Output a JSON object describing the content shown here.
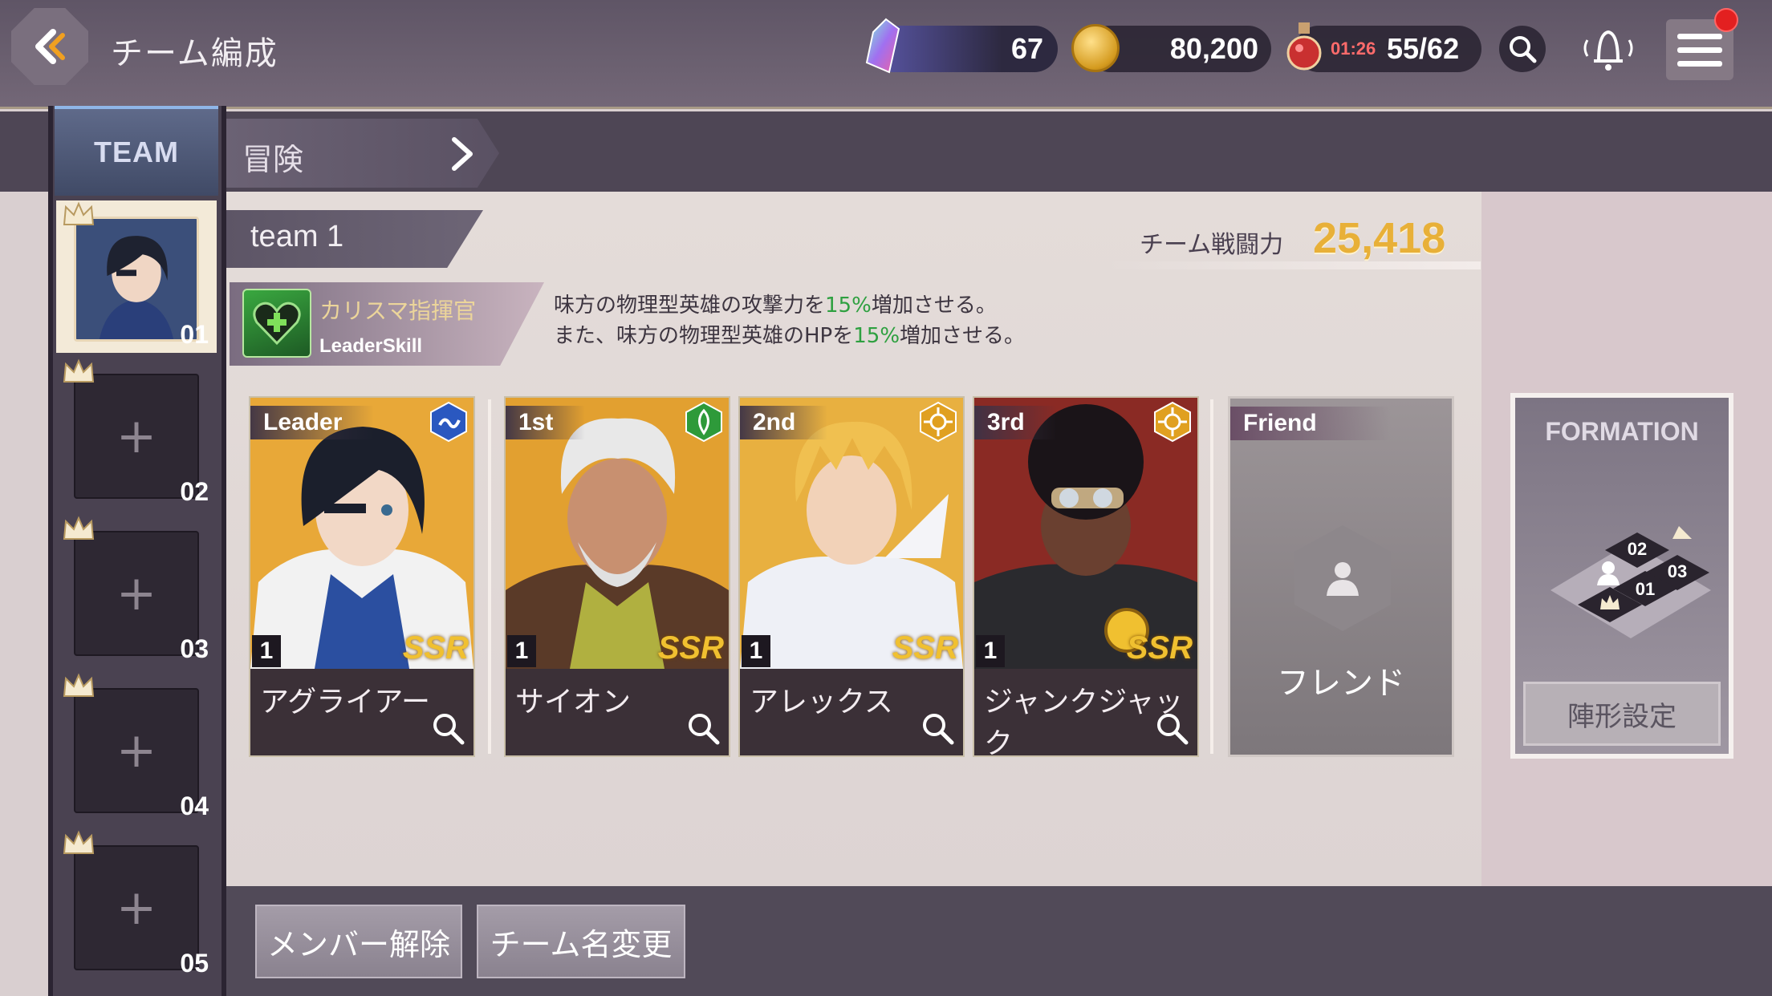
{
  "header": {
    "title": "チーム編成",
    "gems": "67",
    "coins": "80,200",
    "stamina_timer": "01:26",
    "stamina": "55/62"
  },
  "nav": {
    "team_tab": "TEAM",
    "adventure_tab": "冒険"
  },
  "team_slots": [
    {
      "num": "01"
    },
    {
      "num": "02"
    },
    {
      "num": "03"
    },
    {
      "num": "04"
    },
    {
      "num": "05"
    }
  ],
  "team": {
    "name": "team 1",
    "power_label": "チーム戦闘力",
    "power": "25,418"
  },
  "leader_skill": {
    "name": "カリスマ指揮官",
    "sub": "LeaderSkill",
    "line1_a": "味方の物理型英雄の攻撃力を",
    "line1_pct": "15%",
    "line1_b": "増加させる。",
    "line2_a": "また、味方の物理型英雄のHPを",
    "line2_pct": "15%",
    "line2_b": "増加させる。"
  },
  "cards": [
    {
      "role": "Leader",
      "name": "アグライアー",
      "level": "1",
      "rarity": "SSR",
      "element": "water",
      "accent": "#3a6fd0"
    },
    {
      "role": "1st",
      "name": "サイオン",
      "level": "1",
      "rarity": "SSR",
      "element": "earth",
      "accent": "#3aa040"
    },
    {
      "role": "2nd",
      "name": "アレックス",
      "level": "1",
      "rarity": "SSR",
      "element": "light",
      "accent": "#e0a020"
    },
    {
      "role": "3rd",
      "name": "ジャンクジャック",
      "level": "1",
      "rarity": "SSR",
      "element": "light",
      "accent": "#e0a020"
    }
  ],
  "friend": {
    "role": "Friend",
    "label": "フレンド"
  },
  "formation": {
    "title": "FORMATION",
    "button": "陣形設定",
    "positions": [
      "02",
      "03",
      "01"
    ]
  },
  "buttons": {
    "remove_member": "メンバー解除",
    "rename_team": "チーム名変更"
  }
}
